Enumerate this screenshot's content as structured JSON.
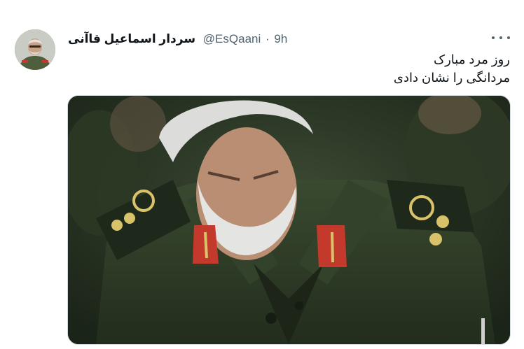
{
  "tweet": {
    "display_name": "سردار اسماعیل قاآنی",
    "handle": "@EsQaani",
    "separator": "·",
    "time": "9h",
    "text_lines": [
      "روز مرد مبارک",
      "مردانگی را نشان دادی"
    ]
  },
  "icons": {
    "more": "more-horizontal-icon"
  },
  "colors": {
    "name": "#0f1419",
    "secondary": "#536471",
    "uniform": "#2f3d27",
    "insignia_red": "#c33a2c",
    "insignia_gold": "#d8c36a"
  }
}
